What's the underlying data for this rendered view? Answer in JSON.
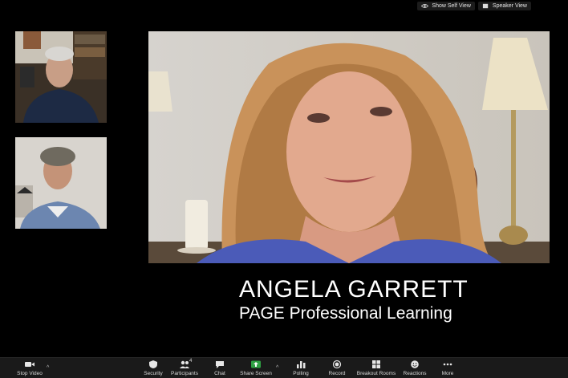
{
  "top_controls": {
    "show_self_view": "Show Self View",
    "speaker_view": "Speaker View"
  },
  "main_speaker": {
    "name": "ANGELA GARRETT",
    "organization": "PAGE Professional Learning"
  },
  "toolbar": {
    "stop_video": "Stop Video",
    "security": "Security",
    "participants": "Participants",
    "participants_count": "4",
    "chat": "Chat",
    "share_screen": "Share Screen",
    "polling": "Polling",
    "record": "Record",
    "breakout_rooms": "Breakout Rooms",
    "reactions": "Reactions",
    "more": "More"
  },
  "colors": {
    "background": "#000000",
    "toolbar": "#1a1a1a",
    "share_screen_green": "#2ea043"
  }
}
